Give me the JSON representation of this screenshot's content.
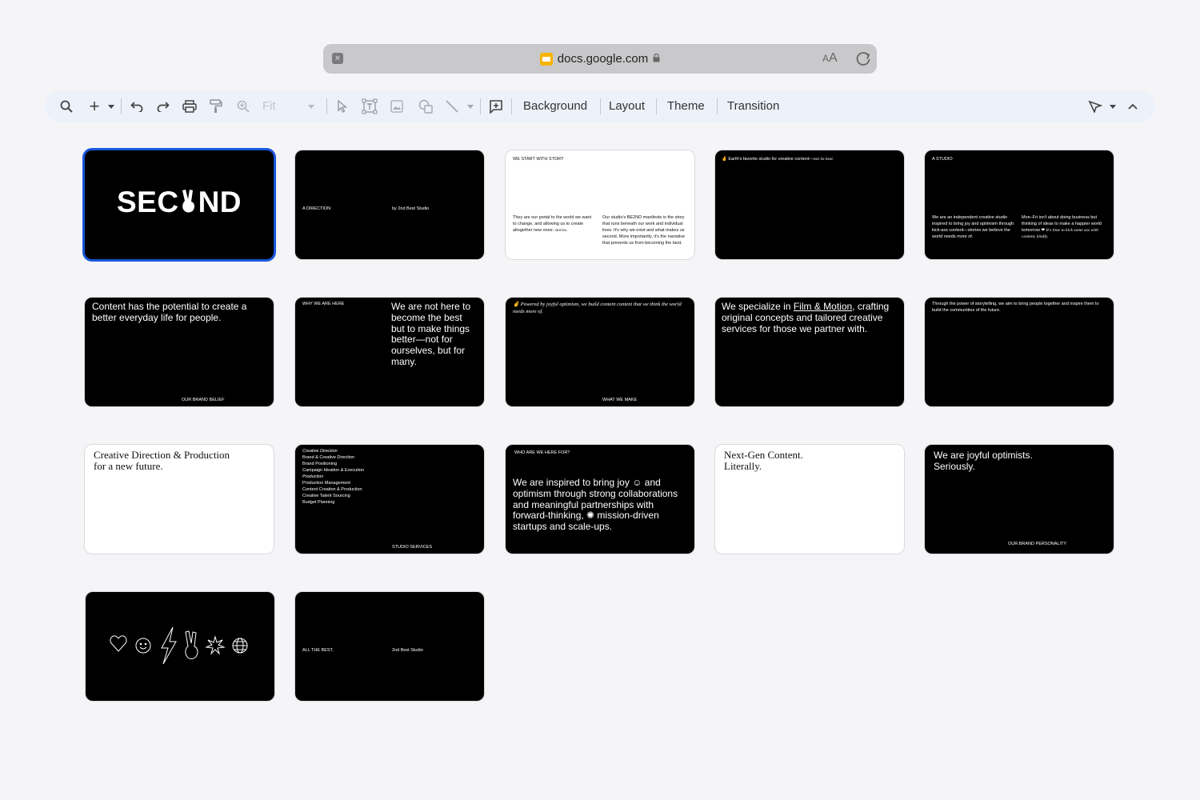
{
  "browser": {
    "url": "docs.google.com",
    "text_size_label_small": "A",
    "text_size_label_large": "A"
  },
  "toolbar": {
    "zoom_value": "Fit",
    "background_label": "Background",
    "layout_label": "Layout",
    "theme_label": "Theme",
    "transition_label": "Transition"
  },
  "slides": {
    "s1": {
      "logo_left": "SEC",
      "logo_right": "ND"
    },
    "s2": {
      "left": "A DIRECTION",
      "right": "by 2nd Best Studio"
    },
    "s3": {
      "heading": "WE START WITH STORY",
      "left_a": "They are our portal to the world we want to change, and allowing us to create altogether new ones:",
      "left_b": "stories.",
      "right": "Our studio's BE2ND manifesto is the story that runs beneath our work and individual lives. It's why we exist and what makes us second. More importantly, it's the narrative that prevents us from becoming the best."
    },
    "s4": {
      "heading_a": "✌ Earth's favorite studio for creative content—",
      "heading_b": "not its best."
    },
    "s5": {
      "heading": "A STUDIO",
      "left": "We are an independent creative studio inspired to bring joy and optimism through kick-ass content—stories we believe the world needs more of.",
      "right_a": "Mon–Fri isn't about doing business but thinking of ideas to make a happier world tomorrow ❤",
      "right_b": "It's time to kick some ass with content, kindly."
    },
    "s6": {
      "body": "Content has the potential to create a better everyday life for people.",
      "footer": "OUR BRAND BELIEF"
    },
    "s7": {
      "left": "WHY WE ARE HERE",
      "body": "We are not here to become the best but to make things better—not for ourselves, but for many."
    },
    "s8": {
      "body": "✌ Powered by joyful optimism, we build content content that we think the world needs more of.",
      "footer": "WHAT WE MAKE"
    },
    "s9": {
      "body_a": "We specialize in ",
      "body_link": "Film & Motion",
      "body_b": ", crafting original concepts and tailored creative services for those we partner with."
    },
    "s10": {
      "body": "Through the power of storytelling, we aim to bring people together and inspire them to build the communities of the future."
    },
    "s11": {
      "line1": "Creative Direction & Production",
      "line2": "for a new future."
    },
    "s12": {
      "items": [
        "Creative Direction",
        "Brand & Creative Direction",
        "Brand Positioning",
        "Campaign Ideation & Execution",
        "Production",
        "Production Management",
        "Content Creation & Production",
        "Creative Talent Sourcing",
        "Budget Planning"
      ],
      "footer": "STUDIO SERVICES"
    },
    "s13": {
      "heading": "WHO ARE WE HERE FOR?",
      "body_a": "We are inspired to bring joy ☺ and optimism through strong collaborations and meaningful partnerships with forward-thinking, ✺ mission-driven startups and scale-ups."
    },
    "s14": {
      "line1": "Next-Gen Content.",
      "line2": "Literally."
    },
    "s15": {
      "line1": "We are joyful optimists.",
      "line2": "Seriously.",
      "footer": "OUR BRAND PERSONALITY"
    },
    "s17": {
      "left": "ALL THE BEST,",
      "right": "2nd Best Studio"
    }
  }
}
